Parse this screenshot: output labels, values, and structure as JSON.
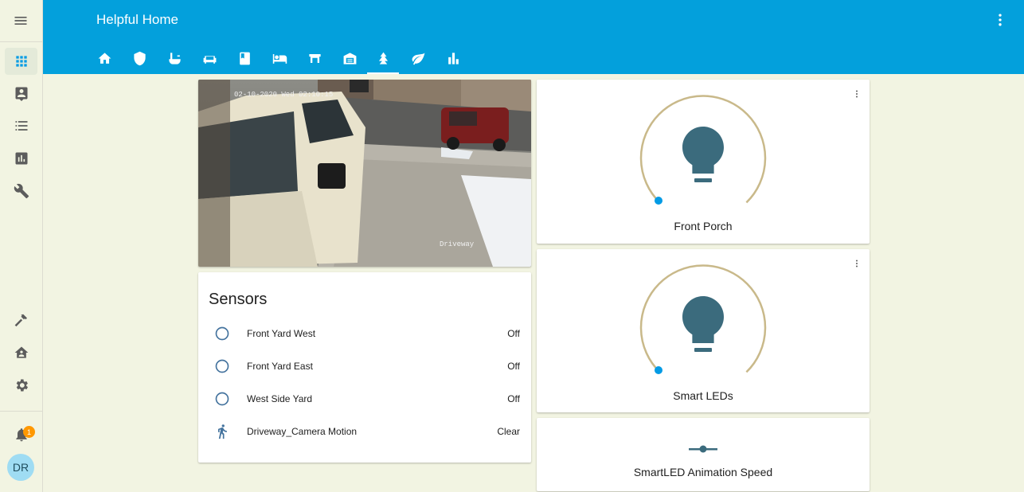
{
  "app": {
    "title": "Helpful Home"
  },
  "colors": {
    "header": "#03a0dc",
    "accent": "#039be5",
    "icon": "#44739e",
    "bulb": "#3b6b7d",
    "dial_track": "#c9b98a",
    "badge": "#ff9800",
    "background": "#f2f4e2"
  },
  "sidebar": {
    "items": [
      {
        "icon": "dashboard-grid-icon",
        "active": true
      },
      {
        "icon": "person-card-icon"
      },
      {
        "icon": "list-icon"
      },
      {
        "icon": "chart-box-icon"
      },
      {
        "icon": "wrench-icon"
      },
      {
        "icon": "hammer-icon"
      },
      {
        "icon": "home-account-icon"
      },
      {
        "icon": "gear-icon"
      }
    ],
    "notifications": {
      "icon": "bell-icon",
      "count": "1"
    },
    "user": {
      "initials": "DR"
    }
  },
  "tabs": [
    {
      "icon": "home-icon"
    },
    {
      "icon": "shield-icon"
    },
    {
      "icon": "faucet-icon"
    },
    {
      "icon": "sofa-icon"
    },
    {
      "icon": "book-icon"
    },
    {
      "icon": "bed-icon"
    },
    {
      "icon": "garage-door-icon"
    },
    {
      "icon": "warehouse-icon"
    },
    {
      "icon": "pine-tree-icon",
      "active": true
    },
    {
      "icon": "leaf-icon"
    },
    {
      "icon": "bar-chart-icon"
    }
  ],
  "camera": {
    "timestamp_overlay": "02-10-2020 Wed 02:10:15",
    "name_overlay": "Driveway"
  },
  "sensors": {
    "title": "Sensors",
    "rows": [
      {
        "name": "Front Yard West",
        "state": "Off",
        "icon": "circle-outline-icon"
      },
      {
        "name": "Front Yard East",
        "state": "Off",
        "icon": "circle-outline-icon"
      },
      {
        "name": "West Side Yard",
        "state": "Off",
        "icon": "circle-outline-icon"
      },
      {
        "name": "Driveway_Camera Motion",
        "state": "Clear",
        "icon": "walk-icon"
      }
    ]
  },
  "lights": [
    {
      "name": "Front Porch",
      "brightness": 0
    },
    {
      "name": "Smart LEDs",
      "brightness": 0
    }
  ],
  "speed": {
    "name": "SmartLED Animation Speed",
    "icon": "slider-icon"
  }
}
